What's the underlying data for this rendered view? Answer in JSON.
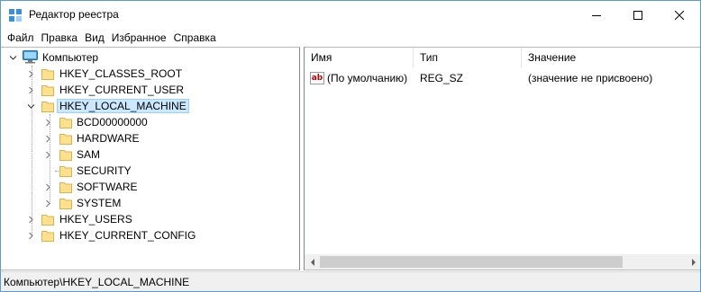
{
  "window": {
    "title": "Редактор реестра",
    "accent_color": "#5b9bd5"
  },
  "menu": {
    "items": [
      "Файл",
      "Правка",
      "Вид",
      "Избранное",
      "Справка"
    ]
  },
  "tree": {
    "root_label": "Компьютер",
    "root_icon": "computer-icon",
    "nodes": [
      {
        "label": "HKEY_CLASSES_ROOT",
        "expanded": false,
        "selected": false
      },
      {
        "label": "HKEY_CURRENT_USER",
        "expanded": false,
        "selected": false
      },
      {
        "label": "HKEY_LOCAL_MACHINE",
        "expanded": true,
        "selected": true,
        "children": [
          {
            "label": "BCD00000000",
            "has_children": true
          },
          {
            "label": "HARDWARE",
            "has_children": true
          },
          {
            "label": "SAM",
            "has_children": true
          },
          {
            "label": "SECURITY",
            "has_children": false
          },
          {
            "label": "SOFTWARE",
            "has_children": true
          },
          {
            "label": "SYSTEM",
            "has_children": true
          }
        ]
      },
      {
        "label": "HKEY_USERS",
        "expanded": false,
        "selected": false
      },
      {
        "label": "HKEY_CURRENT_CONFIG",
        "expanded": false,
        "selected": false
      }
    ],
    "selection_color": "#cce8ff",
    "folder_color": "#ffe08c"
  },
  "list": {
    "columns": [
      "Имя",
      "Тип",
      "Значение"
    ],
    "rows": [
      {
        "icon": "reg-sz-icon",
        "icon_text": "ab",
        "name": "(По умолчанию)",
        "type": "REG_SZ",
        "value": "(значение не присвоено)"
      }
    ]
  },
  "status": {
    "path": "Компьютер\\HKEY_LOCAL_MACHINE"
  }
}
